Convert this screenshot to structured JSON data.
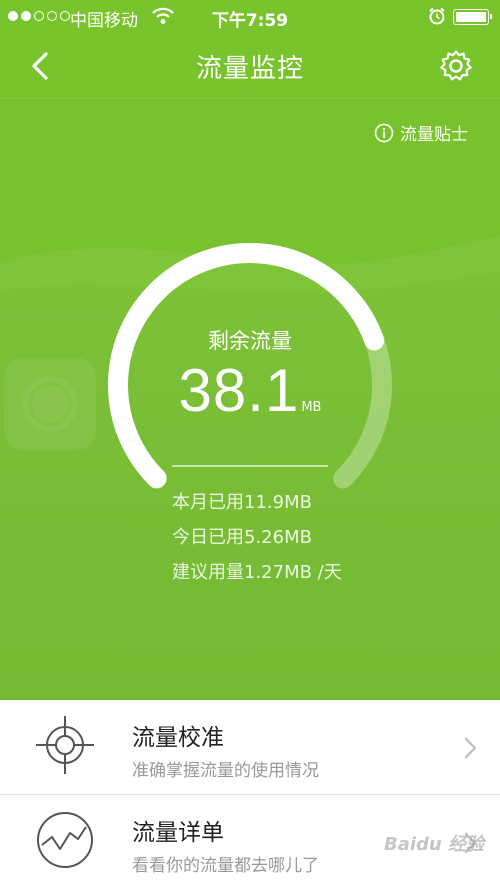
{
  "status_bar": {
    "carrier": "中国移动",
    "time": "下午7:59",
    "signal_bars_filled": 2,
    "signal_bars_total": 5
  },
  "nav": {
    "title": "流量监控",
    "back_icon": "chevron-left-icon",
    "settings_icon": "gear-icon"
  },
  "tips": {
    "label": "流量贴士",
    "icon": "info-icon"
  },
  "gauge": {
    "label": "剩余流量",
    "value": "38.1",
    "unit": "MB",
    "remaining_fraction": 0.76
  },
  "stats": {
    "month_used": "本月已用11.9MB",
    "today_used": "今日已用5.26MB",
    "suggested": "建议用量1.27MB /天"
  },
  "list": [
    {
      "title": "流量校准",
      "subtitle": "准确掌握流量的使用情况",
      "icon": "crosshair-icon"
    },
    {
      "title": "流量详单",
      "subtitle": "看看你的流量都去哪儿了",
      "icon": "trend-chart-icon"
    }
  ],
  "watermark": "Baidu 经验",
  "colors": {
    "hero_green": "#77c22e",
    "text_white": "#ffffff",
    "list_title": "#222222",
    "list_subtitle": "#999999"
  }
}
